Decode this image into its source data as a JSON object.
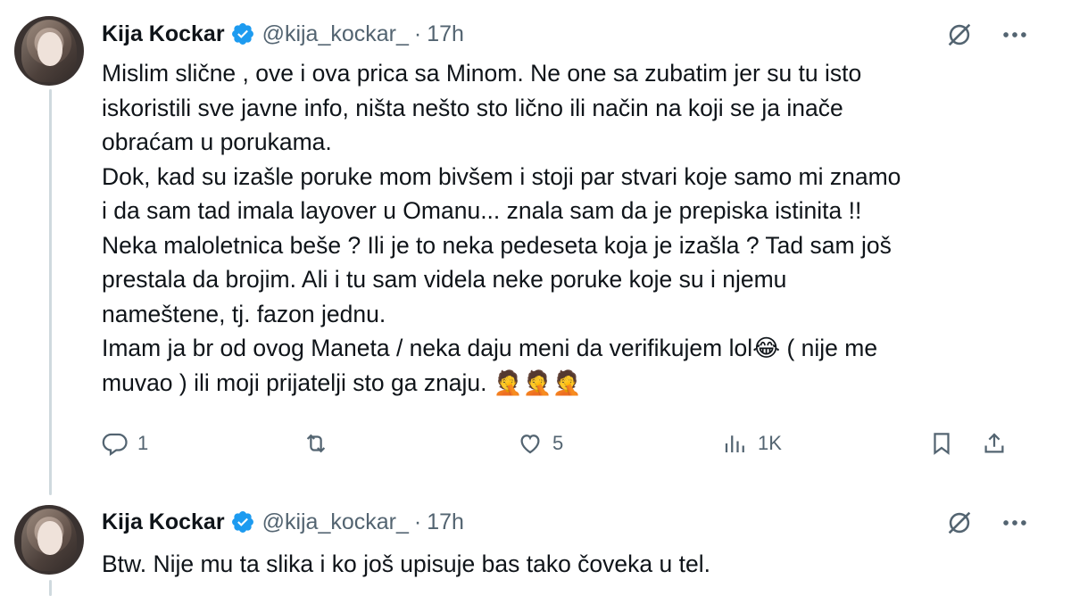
{
  "tweets": [
    {
      "author_name": "Kija Kockar",
      "handle": "@kija_kockar_",
      "separator": "·",
      "time": "17h",
      "text": "Mislim slične , ove i ova prica sa Minom. Ne one sa zubatim jer su tu isto\niskoristili sve javne info, ništa nešto sto lično ili način na koji se ja inače\nobraćam u porukama.\nDok, kad su izašle poruke mom bivšem i stoji par stvari koje samo mi znamo\ni da sam tad imala layover u Omanu... znala sam da je prepiska istinita !!\nNeka maloletnica beše ? Ili je to neka pedeseta koja je izašla ? Tad sam još\nprestala da brojim. Ali i tu sam videla neke poruke koje su i njemu\nnameštene, tj. fazon jednu.\nImam ja br od ovog Maneta / neka daju meni da verifikujem lol😂 ( nije me\nmuvao ) ili moji prijatelji sto ga znaju. 🤦🤦🤦",
      "replies": "1",
      "retweets": "",
      "likes": "5",
      "views": "1K"
    },
    {
      "author_name": "Kija Kockar",
      "handle": "@kija_kockar_",
      "separator": "·",
      "time": "17h",
      "text": "Btw. Nije mu ta slika i ko još upisuje bas tako čoveka u tel."
    }
  ],
  "icons": {
    "verified": "verified-badge-icon",
    "grok": "grok-icon",
    "more": "more-icon",
    "reply": "reply-icon",
    "retweet": "retweet-icon",
    "like": "like-icon",
    "views": "views-icon",
    "bookmark": "bookmark-icon",
    "share": "share-icon"
  },
  "colors": {
    "verified_blue": "#1d9bf0",
    "secondary_text": "#536471",
    "thread_line": "#cfd9de"
  }
}
